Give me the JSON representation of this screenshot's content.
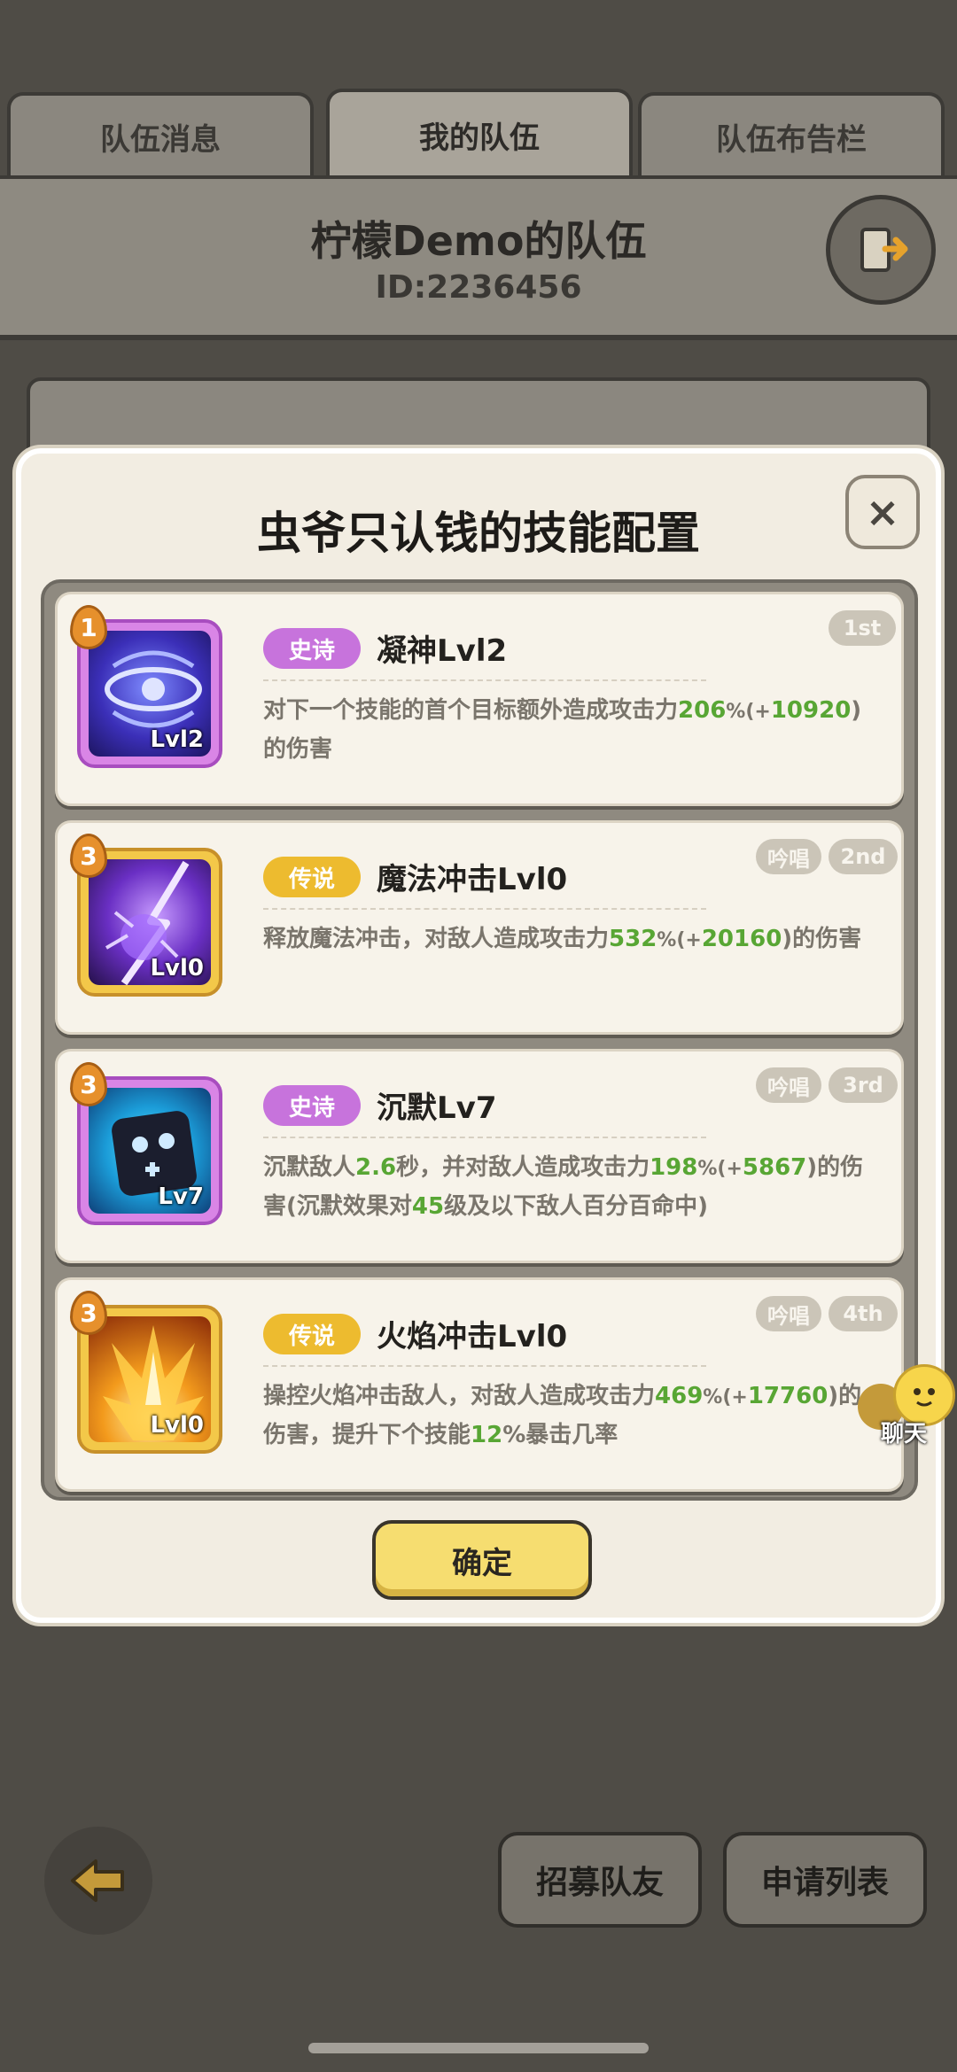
{
  "tabs": [
    {
      "label": "队伍消息"
    },
    {
      "label": "我的队伍"
    },
    {
      "label": "队伍布告栏"
    }
  ],
  "team": {
    "title": "柠檬Demo的队伍",
    "id": "ID:2236456"
  },
  "bottom": {
    "recruit_label": "招募队友",
    "apply_label": "申请列表"
  },
  "modal": {
    "title": "虫爷只认钱的技能配置",
    "close_label": "×",
    "confirm_label": "确定",
    "skills": [
      {
        "rank": "1",
        "level_tag": "Lvl2",
        "rarity": "史诗",
        "name": "凝神Lvl2",
        "order": "1st",
        "chant": "",
        "desc": [
          "对下一个技能的首个目标额外造成攻击力",
          "206",
          "%(+",
          "10920",
          ")的伤害"
        ]
      },
      {
        "rank": "3",
        "level_tag": "Lvl0",
        "rarity": "传说",
        "name": "魔法冲击Lvl0",
        "order": "2nd",
        "chant": "吟唱",
        "desc": [
          "释放魔法冲击，对敌人造成攻击力",
          "532",
          "%(+",
          "20160",
          ")的伤害"
        ]
      },
      {
        "rank": "3",
        "level_tag": "Lv7",
        "rarity": "史诗",
        "name": "沉默Lv7",
        "order": "3rd",
        "chant": "吟唱",
        "desc": [
          "沉默敌人",
          "2.6",
          "秒，并对敌人造成攻击力",
          "198",
          "%(+",
          "5867",
          ")的伤害(沉默效果对",
          "45",
          "级及以下敌人百分百命中)"
        ]
      },
      {
        "rank": "3",
        "level_tag": "Lvl0",
        "rarity": "传说",
        "name": "火焰冲击Lvl0",
        "order": "4th",
        "chant": "吟唱",
        "desc": [
          "操控火焰冲击敌人，对敌人造成攻击力",
          "469",
          "%(+",
          "17760",
          ")的伤害，提升下个技能",
          "12",
          "%暴击几率"
        ]
      }
    ]
  },
  "chat": {
    "label": "聊天"
  },
  "colors": {
    "epic": "#c773dc",
    "legend": "#edbb2f",
    "highlight": "#58a634",
    "confirm": "#f6dd70"
  }
}
